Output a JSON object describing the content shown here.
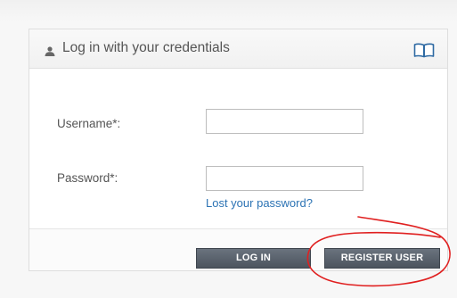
{
  "login_panel": {
    "title": "Log in with your credentials",
    "header_icon": "user-icon",
    "help_icon": "book-icon"
  },
  "form": {
    "username": {
      "label": "Username*:",
      "value": "",
      "placeholder": ""
    },
    "password": {
      "label": "Password*:",
      "value": "",
      "placeholder": ""
    },
    "lost_password_link": "Lost your password?"
  },
  "actions": {
    "login_label": "LOG IN",
    "register_label": "REGISTER USER"
  },
  "colors": {
    "link": "#2c73b4",
    "button": "#5a626c",
    "annotation": "#e02020"
  }
}
